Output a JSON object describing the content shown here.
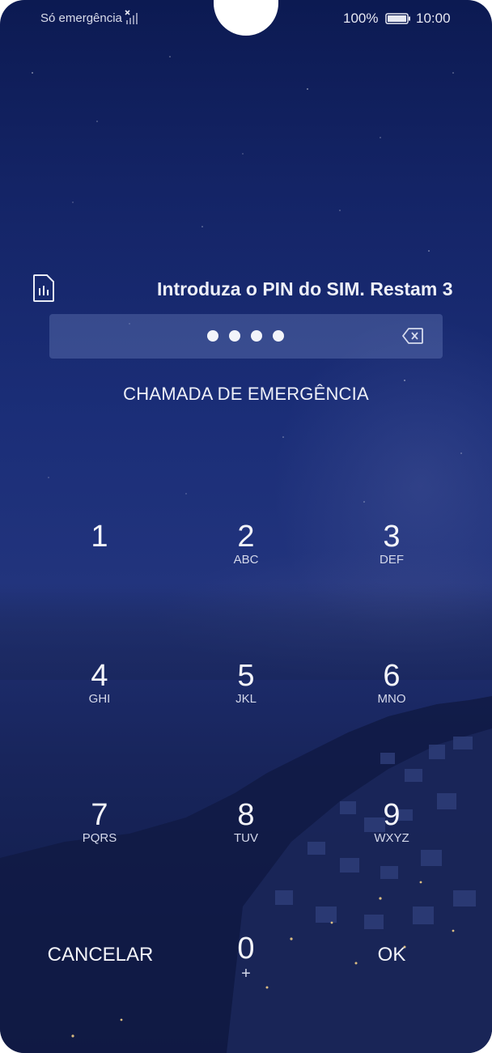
{
  "status_bar": {
    "carrier": "Só emergência",
    "battery_percent": "100%",
    "time": "10:00"
  },
  "sim_prompt": {
    "message": "Introduza o PIN do SIM. Restam 3",
    "pin_dots_count": 4,
    "icon": "sim-card-icon"
  },
  "emergency_call_label": "CHAMADA DE EMERGÊNCIA",
  "keypad": {
    "keys": [
      {
        "digit": "1",
        "letters": ""
      },
      {
        "digit": "2",
        "letters": "ABC"
      },
      {
        "digit": "3",
        "letters": "DEF"
      },
      {
        "digit": "4",
        "letters": "GHI"
      },
      {
        "digit": "5",
        "letters": "JKL"
      },
      {
        "digit": "6",
        "letters": "MNO"
      },
      {
        "digit": "7",
        "letters": "PQRS"
      },
      {
        "digit": "8",
        "letters": "TUV"
      },
      {
        "digit": "9",
        "letters": "WXYZ"
      },
      {
        "digit": "0",
        "letters": "+"
      }
    ],
    "cancel_label": "CANCELAR",
    "ok_label": "OK"
  },
  "colors": {
    "background_top": "#0c1a52",
    "background_mid": "#22347d",
    "field_bg": "#8ca0dc"
  }
}
